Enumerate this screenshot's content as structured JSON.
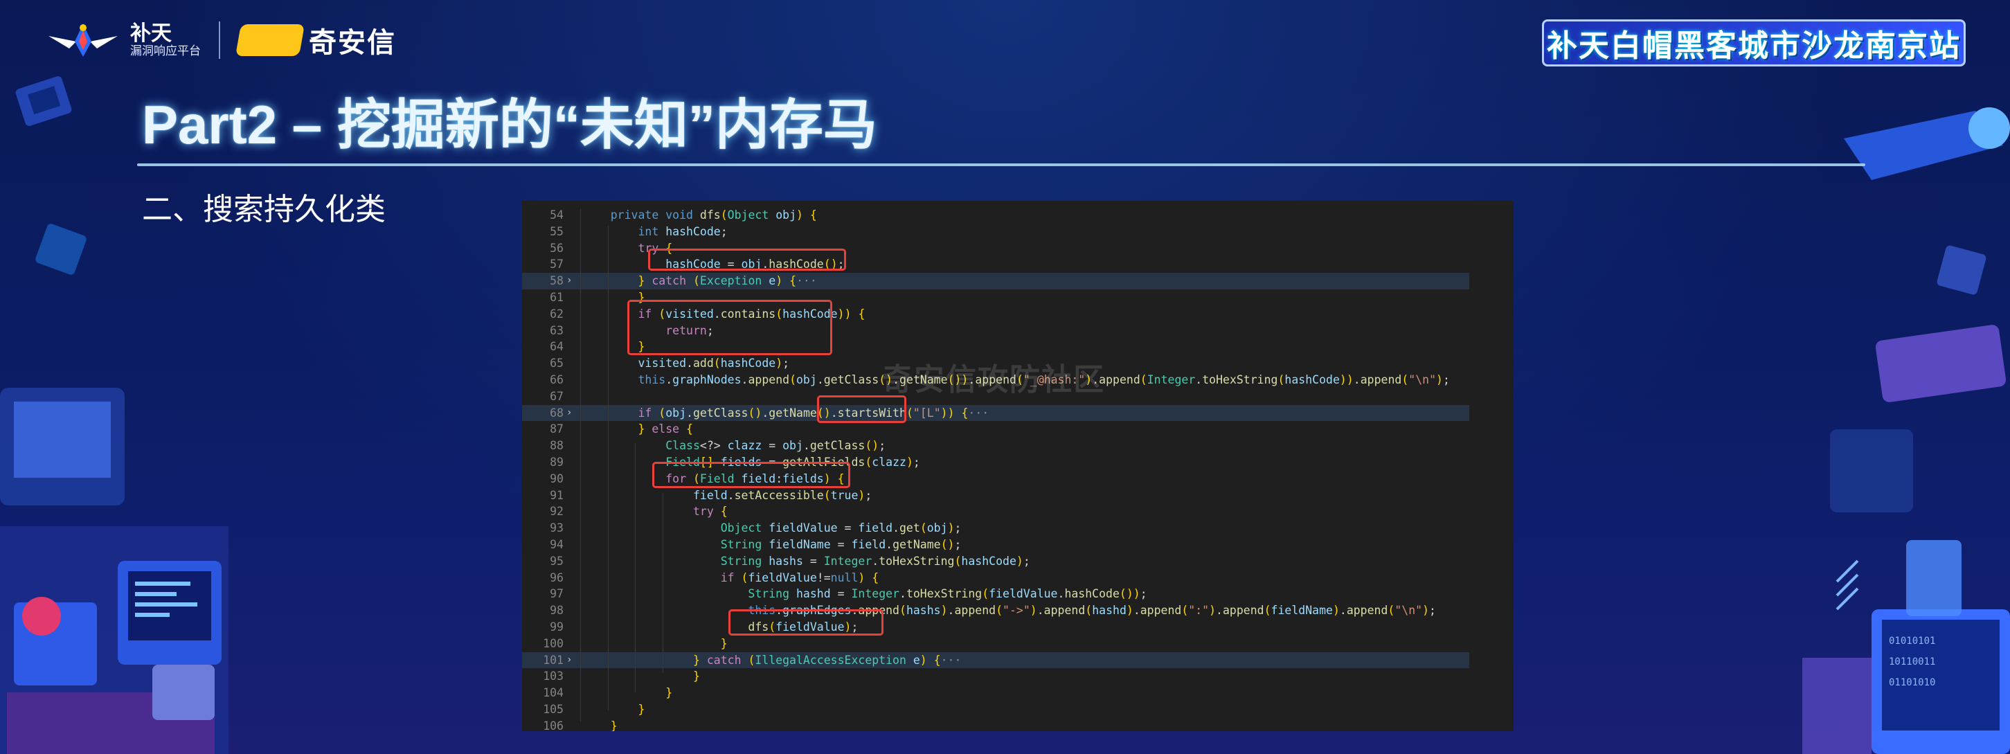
{
  "header": {
    "logo_name": "补天",
    "logo_subtitle": "漏洞响应平台",
    "partner_name": "奇安信",
    "event_title": "补天白帽黑客城市沙龙南京站"
  },
  "slide": {
    "title": "Part2 – 挖掘新的“未知”内存马",
    "section": "二、搜索持久化类"
  },
  "watermark": "奇安信攻防社区",
  "code": {
    "lines": [
      {
        "n": "54",
        "text": "    private void dfs(Object obj) {"
      },
      {
        "n": "55",
        "text": "        int hashCode;"
      },
      {
        "n": "56",
        "text": "        try {"
      },
      {
        "n": "57",
        "text": "            hashCode = obj.hashCode();"
      },
      {
        "n": "58",
        "text": "        } catch (Exception e) {···",
        "fold": "›",
        "highlight": true
      },
      {
        "n": "61",
        "text": "        }"
      },
      {
        "n": "62",
        "text": "        if (visited.contains(hashCode)) {"
      },
      {
        "n": "63",
        "text": "            return;"
      },
      {
        "n": "64",
        "text": "        }"
      },
      {
        "n": "65",
        "text": "        visited.add(hashCode);"
      },
      {
        "n": "66",
        "text": "        this.graphNodes.append(obj.getClass().getName()).append(\"_@hash:\").append(Integer.toHexString(hashCode)).append(\"\\n\");"
      },
      {
        "n": "67",
        "text": ""
      },
      {
        "n": "68",
        "text": "        if (obj.getClass().getName().startsWith(\"[L\")) {···",
        "fold": "›",
        "highlight": true
      },
      {
        "n": "87",
        "text": "        } else {"
      },
      {
        "n": "88",
        "text": "            Class<?> clazz = obj.getClass();"
      },
      {
        "n": "89",
        "text": "            Field[] fields = getAllFields(clazz);"
      },
      {
        "n": "90",
        "text": "            for (Field field:fields) {"
      },
      {
        "n": "91",
        "text": "                field.setAccessible(true);"
      },
      {
        "n": "92",
        "text": "                try {"
      },
      {
        "n": "93",
        "text": "                    Object fieldValue = field.get(obj);"
      },
      {
        "n": "94",
        "text": "                    String fieldName = field.getName();"
      },
      {
        "n": "95",
        "text": "                    String hashs = Integer.toHexString(hashCode);"
      },
      {
        "n": "96",
        "text": "                    if (fieldValue!=null) {"
      },
      {
        "n": "97",
        "text": "                        String hashd = Integer.toHexString(fieldValue.hashCode());"
      },
      {
        "n": "98",
        "text": "                        this.graphEdges.append(hashs).append(\"->\").append(hashd).append(\":\").append(fieldName).append(\"\\n\");"
      },
      {
        "n": "99",
        "text": "                        dfs(fieldValue);"
      },
      {
        "n": "100",
        "text": "                    }"
      },
      {
        "n": "101",
        "text": "                } catch (IllegalAccessException e) {···",
        "fold": "›",
        "highlight": true
      },
      {
        "n": "103",
        "text": "                }"
      },
      {
        "n": "104",
        "text": "            }"
      },
      {
        "n": "105",
        "text": "        }"
      },
      {
        "n": "106",
        "text": "    }"
      }
    ]
  },
  "colors": {
    "annotation_box": "#e8413c",
    "code_background": "#1f1f1f",
    "event_badge": "#3552ff"
  }
}
